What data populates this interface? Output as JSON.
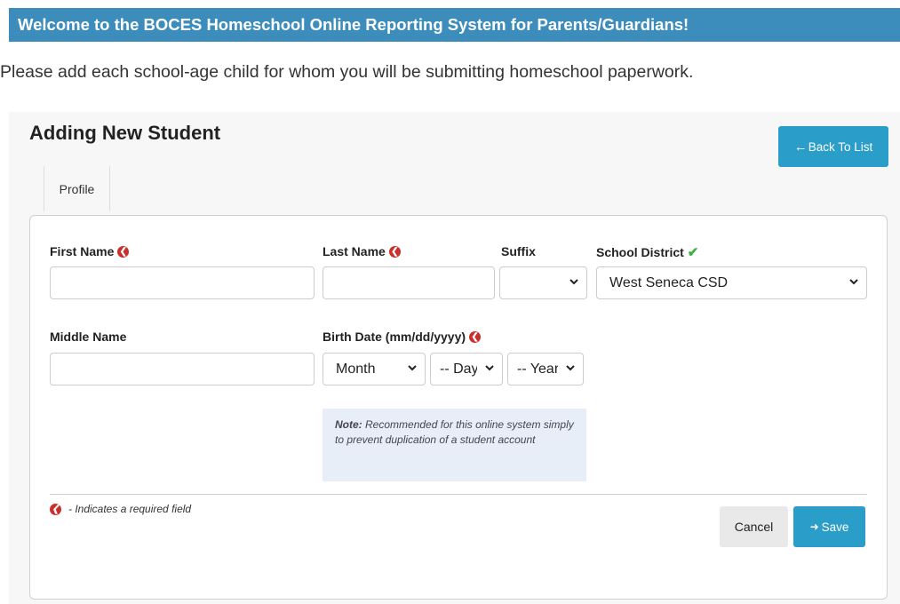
{
  "banner": {
    "text": "Welcome to the BOCES Homeschool Online Reporting System for Parents/Guardians!"
  },
  "intro": {
    "text": "Please add each school-age child for whom you will be submitting homeschool paperwork."
  },
  "form": {
    "heading": "Adding New Student",
    "back_label": "Back To List",
    "tab_profile": "Profile",
    "first_name": {
      "label": "First Name",
      "value": ""
    },
    "last_name": {
      "label": "Last Name",
      "value": ""
    },
    "suffix": {
      "label": "Suffix",
      "selected": ""
    },
    "school_district": {
      "label": "School District",
      "selected": "West Seneca CSD"
    },
    "middle_name": {
      "label": "Middle Name",
      "value": ""
    },
    "birth_date": {
      "label": "Birth Date (mm/dd/yyyy)",
      "month_selected": "Month",
      "day_selected": "-- Day",
      "year_selected": "-- Year"
    },
    "note": {
      "prefix": "Note:",
      "text": "Recommended for this online system simply to prevent duplication of a student account"
    },
    "legend": "- Indicates a required field",
    "cancel_label": "Cancel",
    "save_label": "Save"
  },
  "colors": {
    "banner": "#3c8dbc",
    "primary_button": "#2a9dc8",
    "required": "#c9302c",
    "valid": "#3cb043",
    "note_bg": "#e8eef8"
  },
  "icons": {
    "required": "circle-arrow-left-icon",
    "valid": "checkmark-icon",
    "back": "arrow-left-icon",
    "save": "sign-in-icon",
    "dropdown": "chevron-down-icon"
  }
}
